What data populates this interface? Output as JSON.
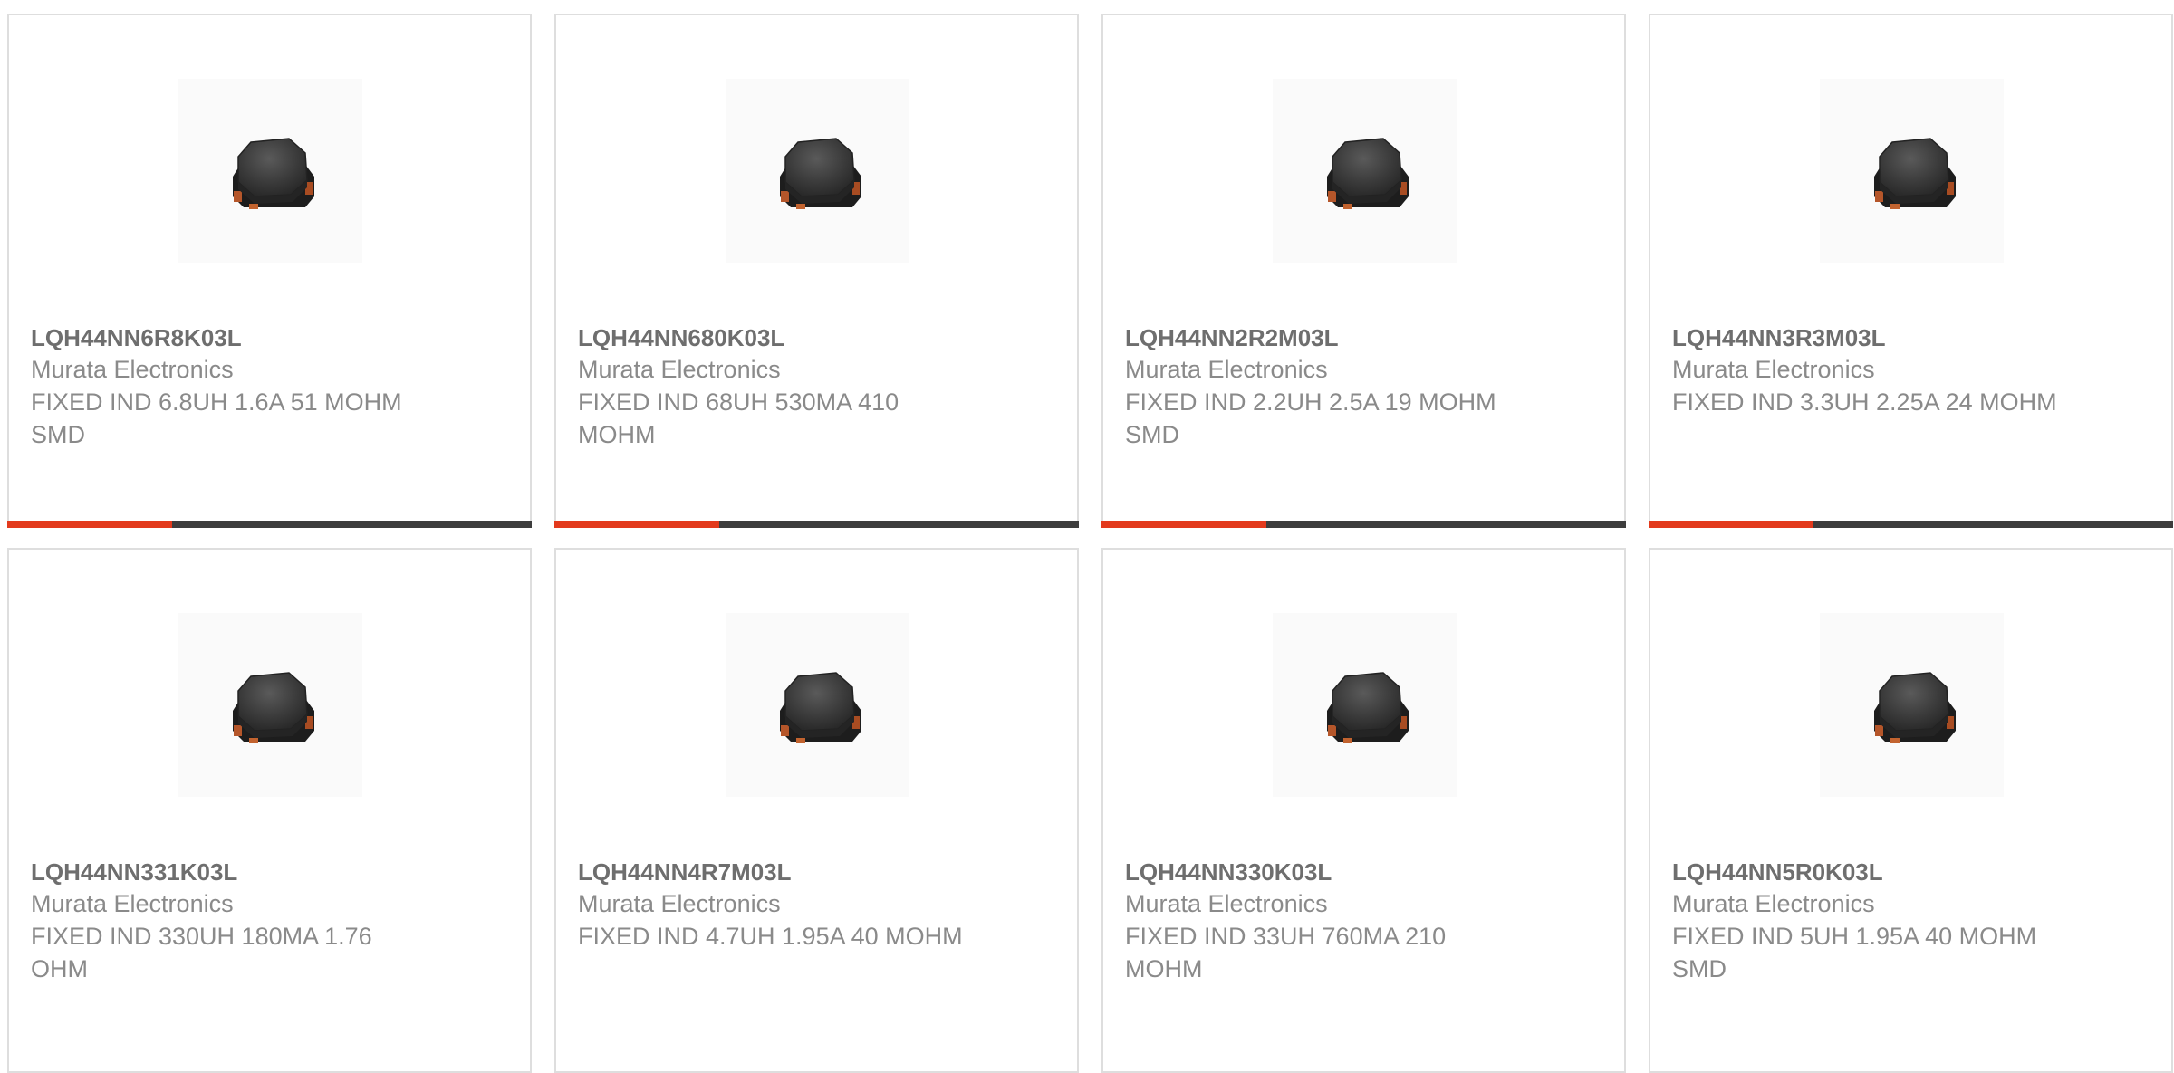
{
  "theme": {
    "accent_color": "#e33a1d",
    "bar_color": "#3d3d3d",
    "border_color": "#dedede"
  },
  "products": [
    {
      "part_number": "LQH44NN6R8K03L",
      "manufacturer": "Murata Electronics",
      "description": "FIXED IND 6.8UH 1.6A 51 MOHM SMD",
      "image_icon": "smd-inductor-icon",
      "hover_bar_visible": true,
      "hover_bar_progress": 0.315
    },
    {
      "part_number": "LQH44NN680K03L",
      "manufacturer": "Murata Electronics",
      "description": "FIXED IND 68UH 530MA 410 MOHM",
      "image_icon": "smd-inductor-icon",
      "hover_bar_visible": true,
      "hover_bar_progress": 0.315
    },
    {
      "part_number": "LQH44NN2R2M03L",
      "manufacturer": "Murata Electronics",
      "description": "FIXED IND 2.2UH 2.5A 19 MOHM SMD",
      "image_icon": "smd-inductor-icon",
      "hover_bar_visible": true,
      "hover_bar_progress": 0.315
    },
    {
      "part_number": "LQH44NN3R3M03L",
      "manufacturer": "Murata Electronics",
      "description": "FIXED IND 3.3UH 2.25A 24 MOHM",
      "image_icon": "smd-inductor-icon",
      "hover_bar_visible": true,
      "hover_bar_progress": 0.315
    },
    {
      "part_number": "LQH44NN331K03L",
      "manufacturer": "Murata Electronics",
      "description": "FIXED IND 330UH 180MA 1.76 OHM",
      "image_icon": "smd-inductor-icon",
      "hover_bar_visible": false,
      "hover_bar_progress": 0
    },
    {
      "part_number": "LQH44NN4R7M03L",
      "manufacturer": "Murata Electronics",
      "description": "FIXED IND 4.7UH 1.95A 40 MOHM",
      "image_icon": "smd-inductor-icon",
      "hover_bar_visible": false,
      "hover_bar_progress": 0
    },
    {
      "part_number": "LQH44NN330K03L",
      "manufacturer": "Murata Electronics",
      "description": "FIXED IND 33UH 760MA 210 MOHM",
      "image_icon": "smd-inductor-icon",
      "hover_bar_visible": false,
      "hover_bar_progress": 0
    },
    {
      "part_number": "LQH44NN5R0K03L",
      "manufacturer": "Murata Electronics",
      "description": "FIXED IND 5UH 1.95A 40 MOHM SMD",
      "image_icon": "smd-inductor-icon",
      "hover_bar_visible": false,
      "hover_bar_progress": 0
    }
  ]
}
